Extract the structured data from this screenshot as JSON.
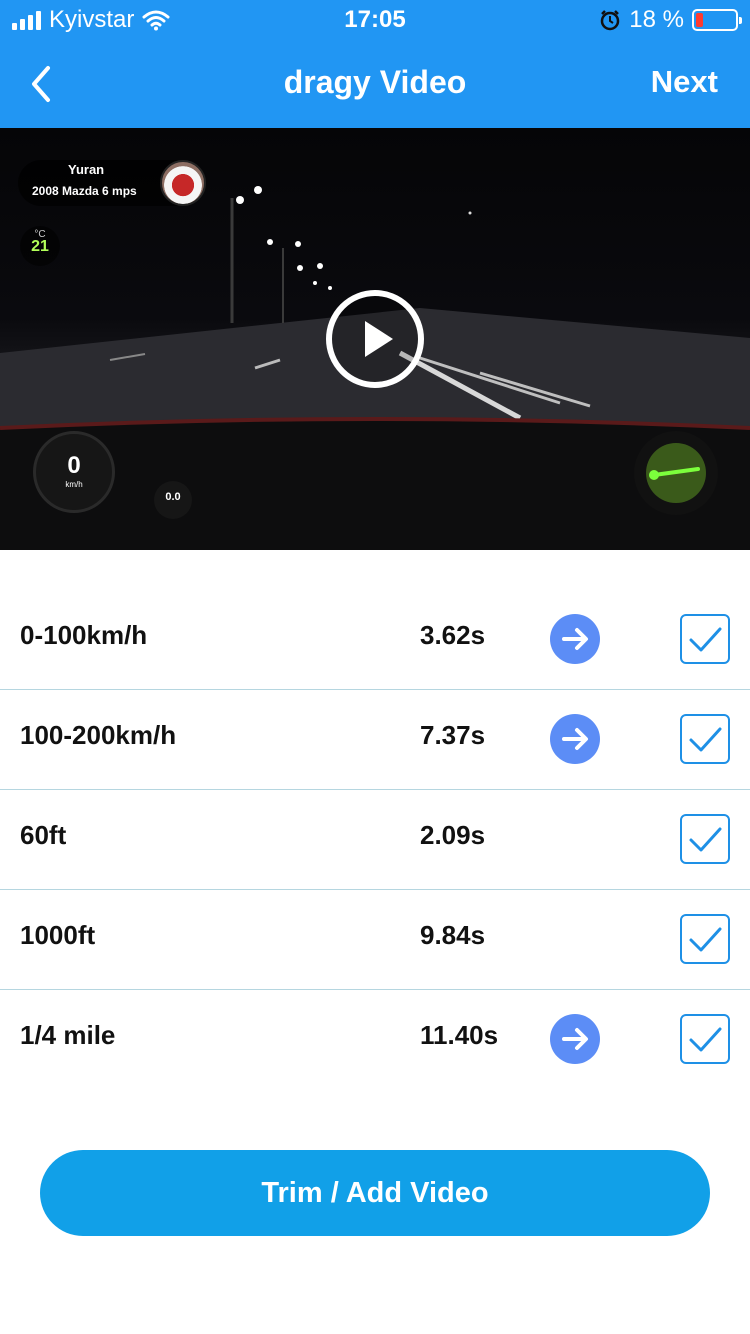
{
  "status_bar": {
    "carrier": "Kyivstar",
    "time": "17:05",
    "battery_percent": "18 %",
    "battery_level": 0.18
  },
  "nav": {
    "title": "dragy Video",
    "next_label": "Next",
    "back_icon": "chevron-left-icon"
  },
  "video": {
    "driver_name": "Yuran",
    "car": "2008 Mazda 6 mps",
    "temp_unit": "°C",
    "temp_value": "21",
    "speed_value": "0",
    "speed_unit": "km/h",
    "g_value": "0.0"
  },
  "results": [
    {
      "label": "0-100km/h",
      "time": "3.62s",
      "has_arrow": true,
      "checked": true
    },
    {
      "label": "100-200km/h",
      "time": "7.37s",
      "has_arrow": true,
      "checked": true
    },
    {
      "label": "60ft",
      "time": "2.09s",
      "has_arrow": false,
      "checked": true
    },
    {
      "label": "1000ft",
      "time": "9.84s",
      "has_arrow": false,
      "checked": true
    },
    {
      "label": "1/4 mile",
      "time": "11.40s",
      "has_arrow": true,
      "checked": true
    }
  ],
  "trim_button_label": "Trim / Add Video",
  "colors": {
    "header": "#2196f3",
    "button": "#11a0e8",
    "arrow_button": "#5c8df6",
    "checkbox": "#1e90e6",
    "battery_low": "#ff3b30"
  }
}
